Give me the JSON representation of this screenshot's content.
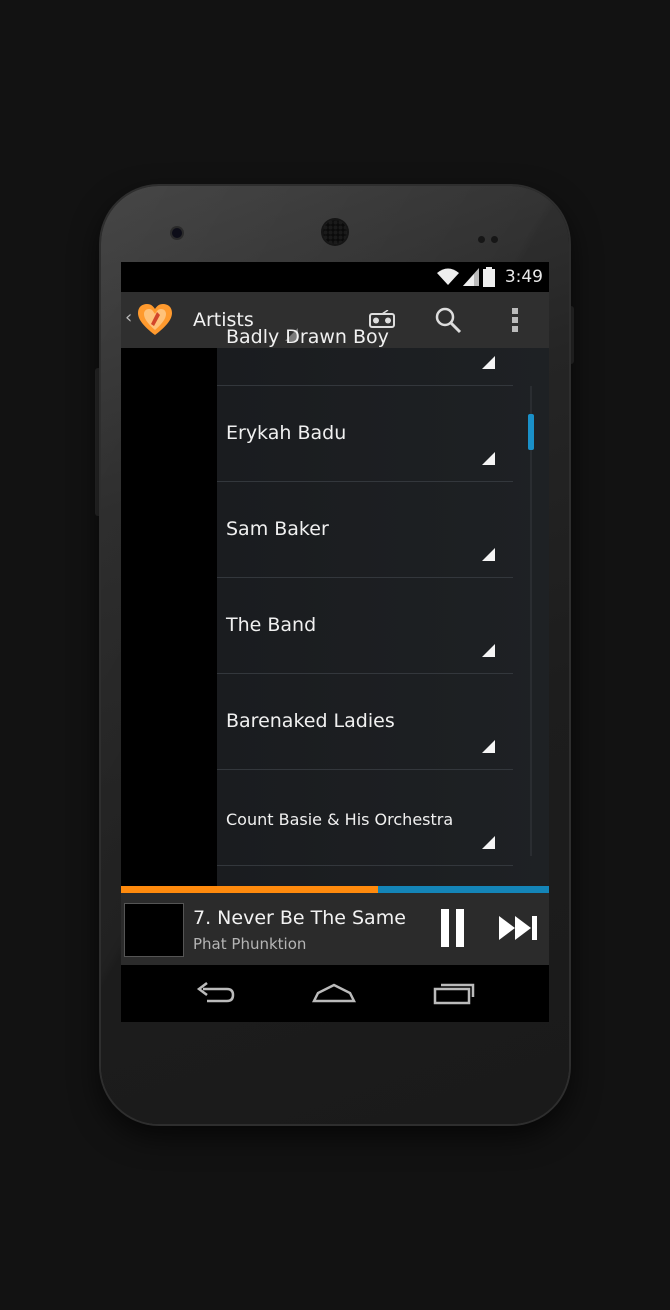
{
  "status_bar": {
    "time": "3:49"
  },
  "action_bar": {
    "back_glyph": "‹",
    "title": "Artists",
    "icons": [
      "heart-logo-icon",
      "party-shuffle-icon",
      "search-icon",
      "overflow-menu-icon"
    ]
  },
  "artists": [
    {
      "name": "Badly Drawn Boy"
    },
    {
      "name": "Erykah Badu"
    },
    {
      "name": "Sam Baker"
    },
    {
      "name": "The Band"
    },
    {
      "name": "Barenaked Ladies"
    },
    {
      "name": "Count Basie & His Orchestra"
    }
  ],
  "now_playing": {
    "title": "7. Never Be The Same",
    "artist": "Phat Phunktion",
    "progress": 0.6
  },
  "colors": {
    "accent_orange": "#ff8a0d",
    "accent_blue": "#1485b8",
    "action_bar": "#2f2f2f"
  }
}
